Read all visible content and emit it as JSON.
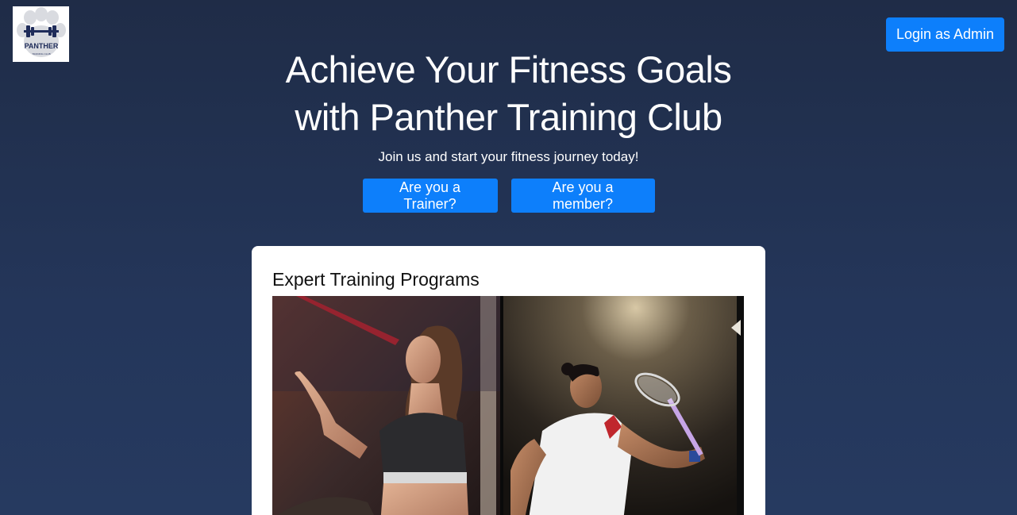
{
  "logo": {
    "text": "PANTHER",
    "subtext": "TRAINING CLUB",
    "accent": "#1f2c5a"
  },
  "header": {
    "admin_button": "Login as Admin"
  },
  "hero": {
    "title_line1": "Achieve Your Fitness Goals",
    "title_line2": "with Panther Training Club",
    "subtitle": "Join us and start your fitness journey today!"
  },
  "cta": {
    "trainer_label": "Are you a Trainer?",
    "member_label": "Are you a member?"
  },
  "card": {
    "title": "Expert Training Programs",
    "image_icon": "fitness-photo-collage"
  },
  "colors": {
    "background_top": "#1f2c47",
    "background_bottom": "#263a60",
    "primary_button": "#0d7ffb",
    "card_bg": "#ffffff"
  }
}
